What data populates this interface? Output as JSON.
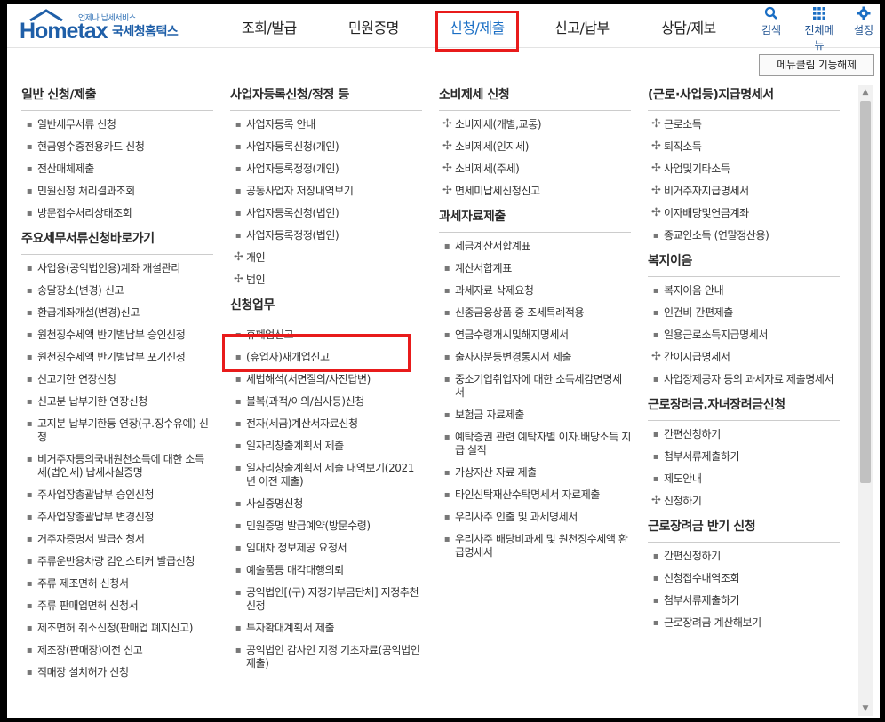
{
  "logo": {
    "sub": "언제나 납세서비스",
    "main": "Hometax",
    "korean": "국세청홈택스"
  },
  "nav": [
    "조회/발급",
    "민원증명",
    "신청/제출",
    "신고/납부",
    "상담/제보"
  ],
  "tools": [
    {
      "icon": "search-icon",
      "label": "검색"
    },
    {
      "icon": "grid-menu-icon",
      "label": "전체메뉴"
    },
    {
      "icon": "gear-icon",
      "label": "설정"
    }
  ],
  "menu_close_label": "메뉴클림 기능해제",
  "columns": [
    [
      {
        "title": "일반 신청/제출",
        "items": [
          {
            "b": "dot",
            "t": "일반세무서류 신청"
          },
          {
            "b": "dot",
            "t": "현금영수증전용카드 신청"
          },
          {
            "b": "dot",
            "t": "전산매체제출"
          },
          {
            "b": "dot",
            "t": "민원신청 처리결과조회"
          },
          {
            "b": "dot",
            "t": "방문접수처리상태조회"
          }
        ]
      },
      {
        "title": "주요세무서류신청바로가기",
        "items": [
          {
            "b": "dot",
            "t": "사업용(공익법인용)계좌 개설관리"
          },
          {
            "b": "dot",
            "t": "송달장소(변경) 신고"
          },
          {
            "b": "dot",
            "t": "환급계좌개설(변경)신고"
          },
          {
            "b": "dot",
            "t": "원천징수세액 반기별납부 승인신청"
          },
          {
            "b": "dot",
            "t": "원천징수세액 반기별납부 포기신청"
          },
          {
            "b": "dot",
            "t": "신고기한 연장신청"
          },
          {
            "b": "dot",
            "t": "신고분 납부기한 연장신청"
          },
          {
            "b": "dot",
            "t": "고지분 납부기한등 연장(구.징수유예) 신청"
          },
          {
            "b": "dot",
            "t": "비거주자등의국내원천소득에 대한 소득세(법인세) 납세사실증명"
          },
          {
            "b": "dot",
            "t": "주사업장총괄납부 승인신청"
          },
          {
            "b": "dot",
            "t": "주사업장총괄납부 변경신청"
          },
          {
            "b": "dot",
            "t": "거주자증명서 발급신청서"
          },
          {
            "b": "dot",
            "t": "주류운반용차량 검인스티커 발급신청"
          },
          {
            "b": "dot",
            "t": "주류 제조면허 신청서"
          },
          {
            "b": "dot",
            "t": "주류 판매업면허 신청서"
          },
          {
            "b": "dot",
            "t": "제조면허 취소신청(판매업 폐지신고)"
          },
          {
            "b": "dot",
            "t": "제조장(판매장)이전 신고"
          },
          {
            "b": "dot",
            "t": "직매장 설치허가 신청"
          }
        ]
      }
    ],
    [
      {
        "title": "사업자등록신청/정정 등",
        "items": [
          {
            "b": "dot",
            "t": "사업자등록 안내"
          },
          {
            "b": "dot",
            "t": "사업자등록신청(개인)"
          },
          {
            "b": "dot",
            "t": "사업자등록정정(개인)"
          },
          {
            "b": "dot",
            "t": "공동사업자 저장내역보기"
          },
          {
            "b": "dot",
            "t": "사업자등록신청(법인)"
          },
          {
            "b": "dot",
            "t": "사업자등록정정(법인)"
          },
          {
            "b": "plus",
            "t": "개인"
          },
          {
            "b": "plus",
            "t": "법인"
          }
        ]
      },
      {
        "title": "신청업무",
        "items": [
          {
            "b": "dot",
            "t": "휴폐업신고"
          },
          {
            "b": "dot",
            "t": "(휴업자)재개업신고"
          },
          {
            "b": "dot",
            "t": "세법해석(서면질의/사전답변)"
          },
          {
            "b": "dot",
            "t": "불복(과적/이의/심사등)신청"
          },
          {
            "b": "dot",
            "t": "전자(세금)계산서자료신청"
          },
          {
            "b": "dot",
            "t": "일자리창출계획서 제출"
          },
          {
            "b": "dot",
            "t": "일자리창출계획서 제출 내역보기(2021년 이전 제출)"
          },
          {
            "b": "dot",
            "t": "사실증명신청"
          },
          {
            "b": "dot",
            "t": "민원증명 발급예약(방문수령)"
          },
          {
            "b": "dot",
            "t": "임대차 정보제공 요청서"
          },
          {
            "b": "dot",
            "t": "예술품등 매각대행의뢰"
          },
          {
            "b": "dot",
            "t": "공익법인[(구) 지정기부금단체] 지정추천 신청"
          },
          {
            "b": "dot",
            "t": "투자확대계획서 제출"
          },
          {
            "b": "dot",
            "t": "공익법인 감사인 지정 기초자료(공익법인 제출)"
          }
        ]
      }
    ],
    [
      {
        "title": "소비제세 신청",
        "items": [
          {
            "b": "plus",
            "t": "소비제세(개별,교통)"
          },
          {
            "b": "plus",
            "t": "소비제세(인지세)"
          },
          {
            "b": "plus",
            "t": "소비제세(주세)"
          },
          {
            "b": "plus",
            "t": "면세미납세신청신고"
          }
        ]
      },
      {
        "title": "과세자료제출",
        "items": [
          {
            "b": "dot",
            "t": "세금계산서합계표"
          },
          {
            "b": "dot",
            "t": "계산서합계표"
          },
          {
            "b": "dot",
            "t": "과세자료 삭제요청"
          },
          {
            "b": "dot",
            "t": "신종금융상품 중 조세특례적용"
          },
          {
            "b": "dot",
            "t": "연금수령개시및해지명세서"
          },
          {
            "b": "dot",
            "t": "출자자분등변경통지서 제출"
          },
          {
            "b": "dot",
            "t": "중소기업취업자에 대한 소득세감면명세서"
          },
          {
            "b": "dot",
            "t": "보험금 자료제출"
          },
          {
            "b": "dot",
            "t": "예탁증권 관련 예탁자별 이자.배당소득 지급 실적"
          },
          {
            "b": "dot",
            "t": "가상자산 자료 제출"
          },
          {
            "b": "dot",
            "t": "타인신탁재산수탁명세서 자료제출"
          },
          {
            "b": "dot",
            "t": "우리사주 인출 및 과세명세서"
          },
          {
            "b": "dot",
            "t": "우리사주 배당비과세 및 원천징수세액 환급명세서"
          }
        ]
      }
    ],
    [
      {
        "title": "(근로·사업등)지급명세서",
        "items": [
          {
            "b": "plus",
            "t": "근로소득"
          },
          {
            "b": "plus",
            "t": "퇴직소득"
          },
          {
            "b": "plus",
            "t": "사업및기타소득"
          },
          {
            "b": "plus",
            "t": "비거주자지급명세서"
          },
          {
            "b": "plus",
            "t": "이자배당및연금계좌"
          },
          {
            "b": "dot",
            "t": "종교인소득 (연말정산용)"
          }
        ]
      },
      {
        "title": "복지이음",
        "items": [
          {
            "b": "dot",
            "t": "복지이음 안내"
          },
          {
            "b": "dot",
            "t": "인건비 간편제출"
          },
          {
            "b": "dot",
            "t": "일용근로소득지급명세서"
          },
          {
            "b": "plus",
            "t": "간이지급명세서"
          },
          {
            "b": "dot",
            "t": "사업장제공자 등의 과세자료 제출명세서"
          }
        ]
      },
      {
        "title": "근로장려금.자녀장려금신청",
        "items": [
          {
            "b": "dot",
            "t": "간편신청하기"
          },
          {
            "b": "dot",
            "t": "첨부서류제출하기"
          },
          {
            "b": "dot",
            "t": "제도안내"
          },
          {
            "b": "plus",
            "t": "신청하기"
          }
        ]
      },
      {
        "title": "근로장려금 반기 신청",
        "items": [
          {
            "b": "dot",
            "t": "간편신청하기"
          },
          {
            "b": "dot",
            "t": "신청접수내역조회"
          },
          {
            "b": "dot",
            "t": "첨부서류제출하기"
          },
          {
            "b": "dot",
            "t": "근로장려금 계산해보기"
          }
        ]
      }
    ]
  ]
}
